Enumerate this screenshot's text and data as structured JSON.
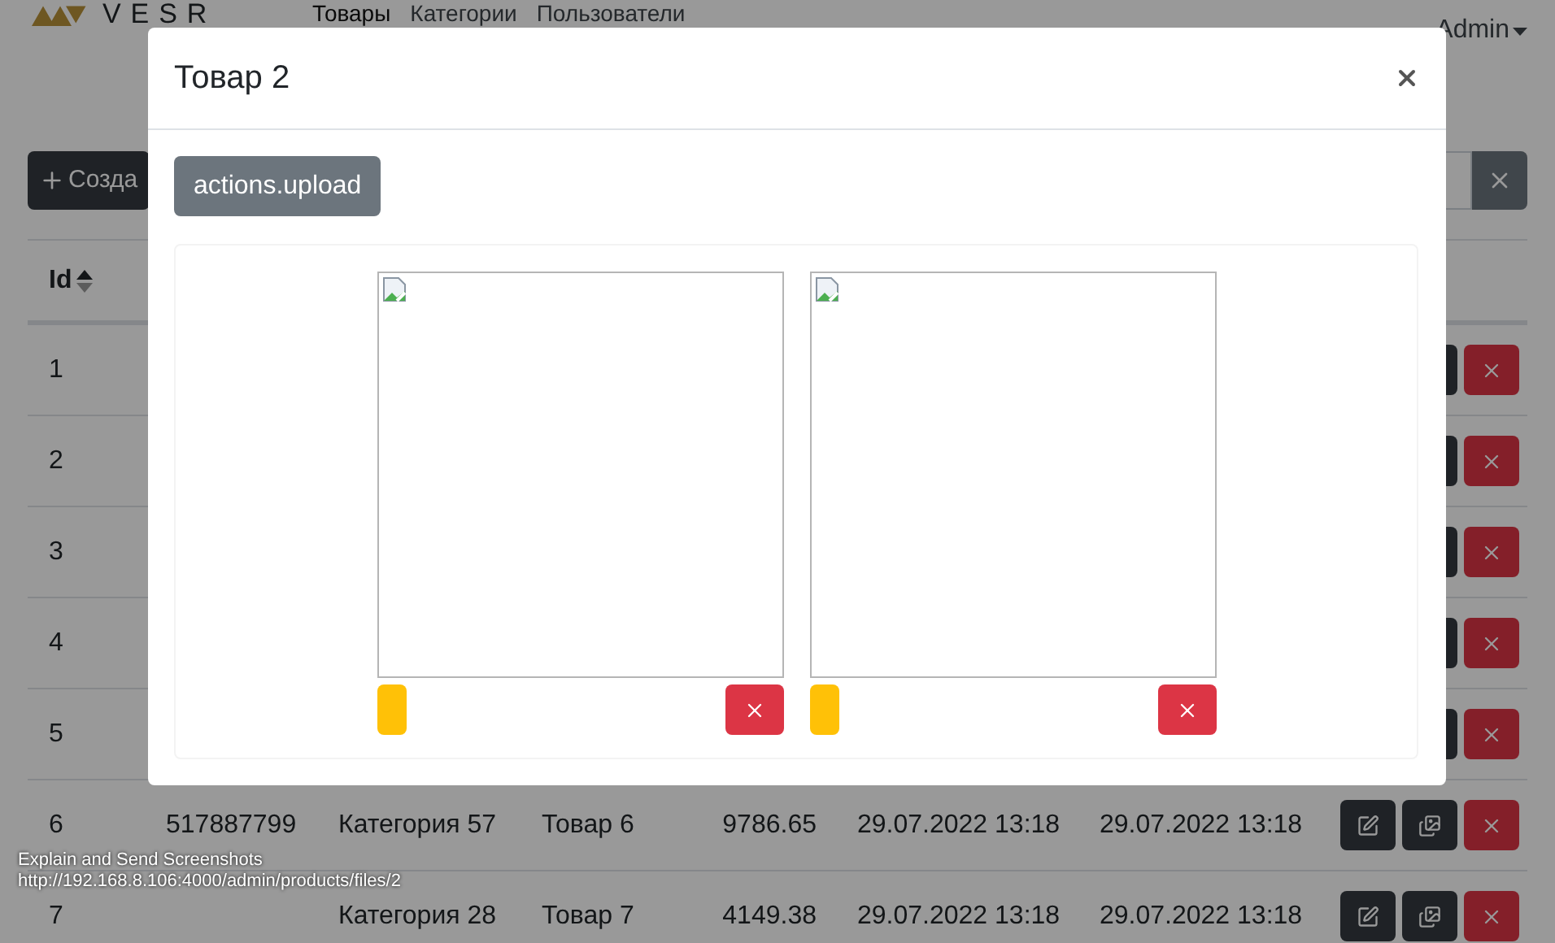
{
  "nav": {
    "logo_text": "VESR",
    "links": [
      {
        "label": "Товары",
        "selected": true
      },
      {
        "label": "Категории",
        "selected": false
      },
      {
        "label": "Пользователи",
        "selected": false
      }
    ],
    "user": "Admin"
  },
  "toolbar": {
    "create_label": "Созда"
  },
  "table": {
    "columns": [
      {
        "label": "Id",
        "sorted": true
      }
    ],
    "rows": [
      {
        "kind": "id_only",
        "id": "1"
      },
      {
        "kind": "id_only",
        "id": "2"
      },
      {
        "kind": "id_only",
        "id": "3"
      },
      {
        "kind": "id_only",
        "id": "4"
      },
      {
        "kind": "id_only",
        "id": "5"
      },
      {
        "kind": "full",
        "id": "6",
        "code": "517887799",
        "category": "Категория 57",
        "name": "Товар 6",
        "price": "9786.65",
        "created": "29.07.2022 13:18",
        "updated": "29.07.2022 13:18"
      },
      {
        "kind": "full",
        "id": "7",
        "category": "Категория 28",
        "name": "Товар 7",
        "price": "4149.38",
        "created": "29.07.2022 13:18",
        "updated": "29.07.2022 13:18"
      }
    ]
  },
  "modal": {
    "title": "Товар 2",
    "upload_label": "actions.upload",
    "images": [
      {
        "kind": "broken"
      },
      {
        "kind": "broken"
      }
    ]
  },
  "status_tooltip": {
    "title": "Explain and Send Screenshots",
    "url": "http://192.168.8.106:4000/admin/products/files/2"
  }
}
